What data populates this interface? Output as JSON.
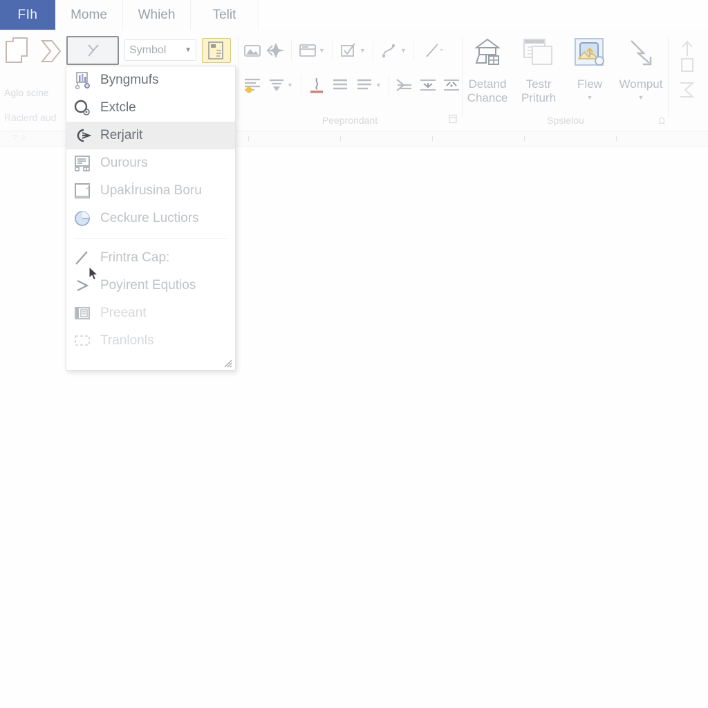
{
  "window": {
    "app_kind": "word-processor-ribbon"
  },
  "tabstrip": {
    "file_tab": "FIh",
    "tabs": [
      {
        "label": "Mome"
      },
      {
        "label": "Whieh"
      },
      {
        "label": "Telit"
      }
    ]
  },
  "ribbon": {
    "groups": [
      {
        "name": "clipboard",
        "label": "Aglo scine",
        "sublabel": "Räclerd aud",
        "icons": [
          "copy-pages-icon",
          "chevron-shape-icon"
        ]
      },
      {
        "name": "font",
        "label": "",
        "selected_button_icon": "slash-glyph-icon",
        "font_combo": {
          "value": "Symbol",
          "caret": "▼"
        },
        "highlight_button_icon": "symbol-insert-icon"
      },
      {
        "name": "paragraph",
        "label": "Peeprondant",
        "launcher_icon": "dialog-launcher-icon",
        "row_one": [
          "picture-icon",
          "sparkle-shape-icon",
          "table-insert-icon",
          "checkbox-tick-icon",
          "connector-line-icon",
          "diagonal-line-icon"
        ],
        "row_two": [
          "align-left-icon",
          "align-filter-icon",
          "text-color-icon",
          "align-center-icon",
          "align-justify-icon",
          "line-spacing-icon",
          "indent-left-icon",
          "indent-right-icon"
        ]
      },
      {
        "name": "styles",
        "label": "Spsielou",
        "launcher_icon": "omega-symbol-icon",
        "items": [
          {
            "icon": "smart-art-icon",
            "label": "Detand\nChance",
            "caret": false
          },
          {
            "icon": "window-stack-icon",
            "label": "Testr\nPriturh",
            "caret": false
          },
          {
            "icon": "media-frame-icon",
            "label": "Flew",
            "caret": true
          },
          {
            "icon": "arrow-bend-icon",
            "label": "Womput",
            "caret": true
          }
        ]
      },
      {
        "name": "editing",
        "label": "",
        "icons": [
          "arrow-up-box-icon",
          "sigma-icon"
        ]
      }
    ]
  },
  "ruler": {
    "tick_count": 6,
    "indent_marker": "▽"
  },
  "menu": {
    "name": "insert-object-menu",
    "items": [
      {
        "label": "Byngmufs",
        "icon": "chart-object-icon",
        "state": "normal",
        "highlighted": false
      },
      {
        "label": "Extcle",
        "icon": "circle-badge-icon",
        "state": "normal",
        "highlighted": false
      },
      {
        "label": "Rerjarit",
        "icon": "stamp-hand-icon",
        "state": "normal",
        "highlighted": true
      },
      {
        "label": "Ourours",
        "icon": "form-fields-icon",
        "state": "dim",
        "highlighted": false
      },
      {
        "label": "Upakİrusina Boru",
        "icon": "blank-page-icon",
        "state": "dim",
        "highlighted": false
      },
      {
        "label": "Ceckure Luctiors",
        "icon": "pie-chart-icon",
        "state": "dim",
        "highlighted": false
      }
    ],
    "items_lower": [
      {
        "label": "Frintra Cap:",
        "icon": "pen-stroke-icon",
        "state": "dim",
        "highlighted": false
      },
      {
        "label": "Poyirent Equtios",
        "icon": "greater-than-icon",
        "state": "dim",
        "highlighted": false
      },
      {
        "label": "Preeant",
        "icon": "slide-panel-icon",
        "state": "dimmer",
        "highlighted": false
      },
      {
        "label": "Tranlonls",
        "icon": "dashed-box-icon",
        "state": "dimmer",
        "highlighted": false
      }
    ],
    "resize_grip": "resize-grip-icon"
  },
  "cursor": {
    "kind": "mouse-pointer-icon"
  },
  "colors": {
    "file_tab_blue": "#4f6bb0",
    "highlight_yellow": "#fdf5c9",
    "highlight_yellow_border": "#d9c97a",
    "menu_highlight": "#ededee",
    "icon_gray": "#9aa0a8",
    "label_gray": "#d6d8db"
  }
}
